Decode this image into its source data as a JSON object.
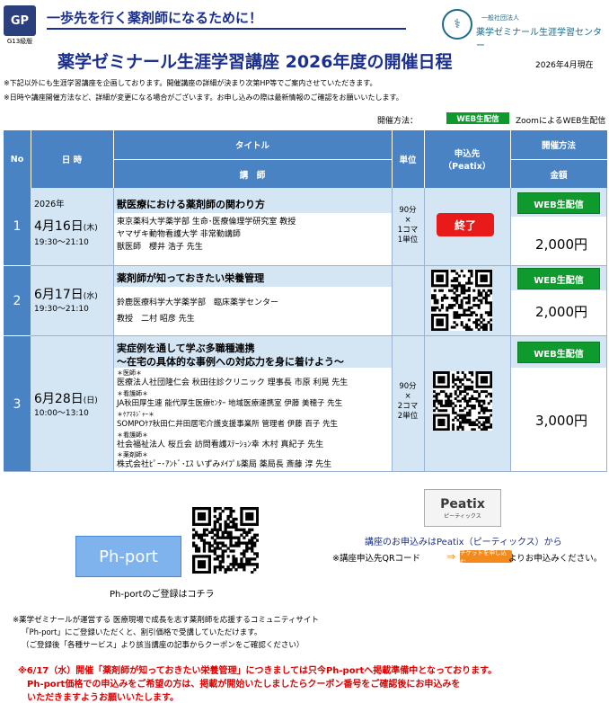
{
  "header": {
    "logo_text": "GP",
    "logo_caption": "G13級版",
    "tagline": "一歩先を行く薬剤師になるために！",
    "org_small": "一般社団法人",
    "org_name": "薬学ゼミナール生涯学習センター",
    "title": "薬学ゼミナール生涯学習講座 2026年度の開催日程",
    "as_of": "2026年4月現在",
    "notes": [
      "※下記以外にも生涯学習講座を企画しております。開催講座の詳細が決まり次第HP等でご案内させていただきます。",
      "※日時や講座開催方法など、詳細が変更になる場合がございます。お申し込みの際は最新情報のご確認をお願いいたします。"
    ],
    "method_label": "開催方法：",
    "web_legend": "WEB生配信",
    "zoom_legend": "ZoomによるWEB生配信"
  },
  "table": {
    "headers": {
      "no": "No",
      "datetime": "日 時",
      "title": "タイトル",
      "lecturer": "講　師",
      "unit": "単位",
      "apply1": "申込先",
      "apply2": "（Peatix）",
      "method": "開催方法",
      "fee": "金額"
    },
    "rows": [
      {
        "no": "1",
        "year": "2026年",
        "date": "4月16日",
        "dow": "(木)",
        "time": "19:30～21:10",
        "title": "獣医療における薬剤師の関わり方",
        "lecturer_lines": [
          "東京薬科大学薬学部 生命･医療倫理学研究室 教授",
          "ヤマザキ動物看護大学 非常勤講師",
          "獣医師　櫻井 浩子 先生"
        ],
        "unit_lines": [
          "90分",
          "×",
          "1コマ",
          "1単位"
        ],
        "apply": "終了",
        "method": "WEB生配信",
        "fee": "2,000円"
      },
      {
        "no": "2",
        "date": "6月17日",
        "dow": "(水)",
        "time": "19:30～21:10",
        "title": "薬剤師が知っておきたい栄養管理",
        "lecturer_lines": [
          "鈴鹿医療科学大学薬学部　臨床薬学センター",
          "教授　二村 昭彦 先生"
        ],
        "method": "WEB生配信",
        "fee": "2,000円"
      },
      {
        "no": "3",
        "date": "6月28日",
        "dow": "(日)",
        "time": "10:00～13:10",
        "title": "実症例を通して学ぶ多職種連携",
        "subtitle": "～在宅の具体的な事例への対応力を身に着けよう～",
        "lecturer_lines": [
          "＊医師＊",
          "医療法人社団隆仁会  秋田往診クリニック 理事長  市原 利晃 先生",
          "＊看護師＊",
          "JA秋田厚生連 能代厚生医療ｾﾝﾀｰ 地域医療連携室  伊藤 美穂子 先生",
          "＊ｹｱﾏﾈｼﾞｬｰ＊",
          "SOMPOｹｱ秋田仁井田居宅介護支援事業所 管理者 伊藤 百子 先生",
          "＊看護師＊",
          "社会福祉法人  桜丘会  訪問看護ｽﾃｰｼｮﾝ幸  木村 真紀子 先生",
          "＊薬剤師＊",
          "株式会社ﾋﾟｰ･ｱﾝﾄﾞ･ｴｽ  いずみﾒｲﾌﾟﾙ薬局 薬局長  斎藤 淳 先生"
        ],
        "unit_lines": [
          "90分",
          "×",
          "2コマ",
          "2単位"
        ],
        "method": "WEB生配信",
        "fee": "3,000円"
      }
    ]
  },
  "bottom": {
    "php_logo": "Ph-port",
    "php_caption": "Ph-portのご登録はコチラ",
    "peatix_logo": "Peatix",
    "peatix_sub": "ピーティックス",
    "peatix_caption": "講座のお申込みはPeatix（ピーティックス）から",
    "qr_note_pre": "※講座申込先QRコード",
    "ticket_btn": "チケットを申し込む",
    "qr_note_post": "よりお申込みください。",
    "community_notes": [
      "※薬学ゼミナールが運営する 医療現場で成長を志す薬剤師を応援するコミュニティサイト",
      "「Ph-port」にご登録いただくと、割引価格で受講していただけます。",
      "（ご登録後「各種サービス」より該当講座の記事からクーポンをご確認ください）"
    ],
    "red_notes": [
      "※6/17（水）開催「薬剤師が知っておきたい栄養管理」につきましては只今Ph-portへ掲載準備中となっております。",
      "Ph-port価格での申込みをご希望の方は、掲載が開始いたしましたらクーポン番号をご確認後にお申込みを",
      "いただきますようお願いいたします。"
    ]
  }
}
